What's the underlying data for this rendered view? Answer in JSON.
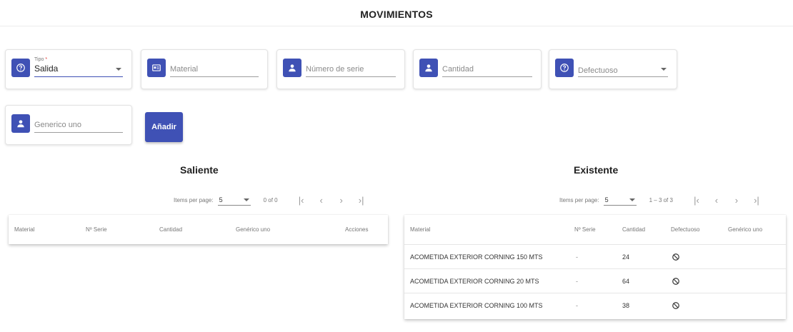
{
  "page": {
    "title": "MOVIMIENTOS"
  },
  "form": {
    "tipo": {
      "label": "Tipo",
      "required_mark": "*",
      "value": "Salida",
      "icon": "help-circle-icon"
    },
    "material": {
      "placeholder": "Material",
      "icon": "id-card-icon"
    },
    "numero_serie": {
      "placeholder": "Número de serie",
      "icon": "person-icon"
    },
    "cantidad": {
      "placeholder": "Cantidad",
      "icon": "person-icon"
    },
    "defectuoso": {
      "placeholder": "Defectuoso",
      "icon": "help-circle-icon"
    },
    "generico_uno": {
      "placeholder": "Generico uno",
      "icon": "person-icon"
    },
    "add_button": "Añadir"
  },
  "saliente": {
    "title": "Saliente",
    "paginator": {
      "items_label": "Items per page:",
      "page_size": "5",
      "range": "0 of 0"
    },
    "columns": [
      "Material",
      "Nº Serie",
      "Cantidad",
      "Genérico uno",
      "Acciones"
    ],
    "rows": []
  },
  "existente": {
    "title": "Existente",
    "paginator": {
      "items_label": "Items per page:",
      "page_size": "5",
      "range": "1 – 3 of 3"
    },
    "columns": [
      "Material",
      "Nº Serie",
      "Cantidad",
      "Defectuoso",
      "Genérico uno"
    ],
    "rows": [
      {
        "material": "ACOMETIDA EXTERIOR CORNING 150 MTS",
        "serie": "-",
        "cantidad": "24",
        "defectuoso_icon": "ban-icon",
        "generico": ""
      },
      {
        "material": "ACOMETIDA EXTERIOR CORNING 20 MTS",
        "serie": "-",
        "cantidad": "64",
        "defectuoso_icon": "ban-icon",
        "generico": ""
      },
      {
        "material": "ACOMETIDA EXTERIOR CORNING 100 MTS",
        "serie": "-",
        "cantidad": "38",
        "defectuoso_icon": "ban-icon",
        "generico": ""
      }
    ]
  },
  "colors": {
    "primary": "#3f51b5",
    "required": "#e53935"
  }
}
